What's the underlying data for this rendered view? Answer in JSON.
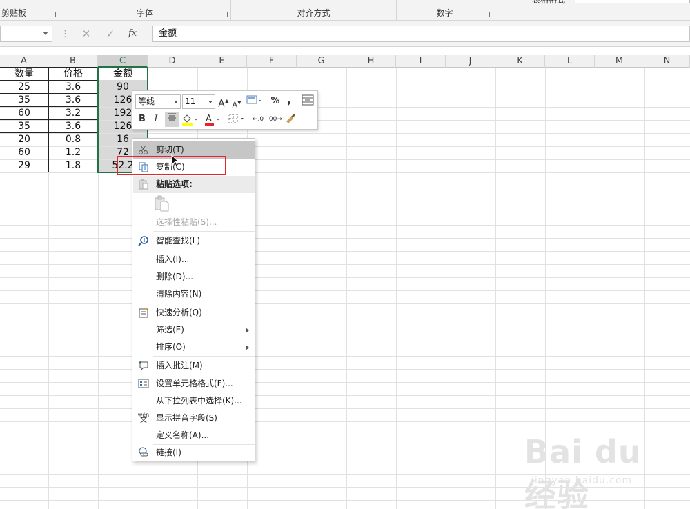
{
  "ribbon": {
    "groups": [
      "剪贴板",
      "字体",
      "对齐方式",
      "数字"
    ],
    "styles_label": "表格格式"
  },
  "formula_bar": {
    "name_box": "",
    "cancel_icon": "close-icon",
    "enter_icon": "check-icon",
    "fx_label": "fx",
    "content": "金额"
  },
  "grid": {
    "columns": [
      "A",
      "B",
      "C",
      "D",
      "E",
      "F",
      "G",
      "H",
      "I",
      "J",
      "K",
      "L",
      "M",
      "N"
    ],
    "selected_column": "C",
    "headers": [
      "数量",
      "价格",
      "金额"
    ],
    "rows": [
      [
        "25",
        "3.6",
        "90"
      ],
      [
        "35",
        "3.6",
        "126"
      ],
      [
        "60",
        "3.2",
        "192"
      ],
      [
        "35",
        "3.6",
        "126"
      ],
      [
        "20",
        "0.8",
        "16"
      ],
      [
        "60",
        "1.2",
        "72"
      ],
      [
        "29",
        "1.8",
        "52.2"
      ]
    ]
  },
  "mini_toolbar": {
    "font_name": "等线",
    "font_size": "11",
    "grow_font": "A",
    "shrink_font": "A",
    "percent": "%",
    "comma": ",",
    "bold": "B",
    "italic": "I",
    "font_color": "A",
    "fill_color": "#ffff00",
    "font_color_value": "#e2272d"
  },
  "context_menu": {
    "items": [
      {
        "label": "剪切(T)",
        "icon": "scissors-icon"
      },
      {
        "label": "复制(C)",
        "icon": "copy-icon"
      },
      {
        "label": "粘贴选项:",
        "icon": "paste-icon"
      },
      {
        "label": "选择性粘贴(S)...",
        "icon": ""
      },
      {
        "label": "智能查找(L)",
        "icon": "smart-lookup-icon"
      },
      {
        "label": "插入(I)...",
        "icon": ""
      },
      {
        "label": "删除(D)...",
        "icon": ""
      },
      {
        "label": "清除内容(N)",
        "icon": ""
      },
      {
        "label": "快速分析(Q)",
        "icon": "quick-analysis-icon"
      },
      {
        "label": "筛选(E)",
        "icon": ""
      },
      {
        "label": "排序(O)",
        "icon": ""
      },
      {
        "label": "插入批注(M)",
        "icon": "comment-icon"
      },
      {
        "label": "设置单元格格式(F)...",
        "icon": "format-cells-icon"
      },
      {
        "label": "从下拉列表中选择(K)...",
        "icon": ""
      },
      {
        "label": "显示拼音字段(S)",
        "icon": "phonetic-icon"
      },
      {
        "label": "定义名称(A)...",
        "icon": ""
      },
      {
        "label": "链接(I)",
        "icon": "link-icon"
      }
    ],
    "phonetic_glyph": "wén\n文"
  },
  "watermark": {
    "main": "Bai du 经验",
    "sub": "jingyan.baidu.com"
  },
  "colors": {
    "accent": "#217346",
    "highlight_box": "#e2272d"
  }
}
